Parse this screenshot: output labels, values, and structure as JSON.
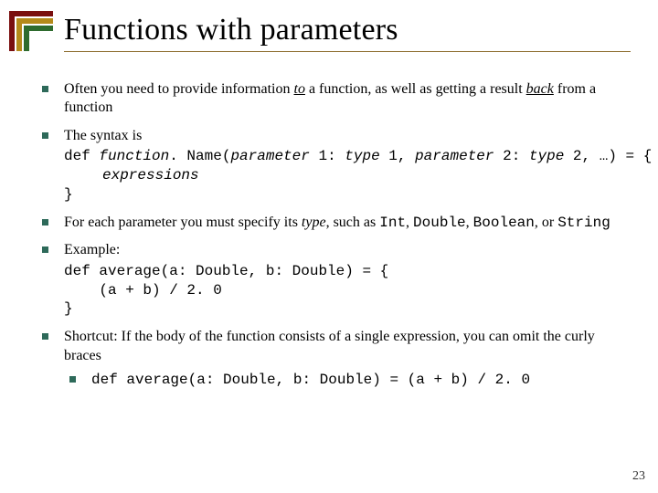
{
  "page_number": "23",
  "title": "Functions with parameters",
  "bullets": [
    {
      "text_parts": {
        "p1": "Often you need to provide information ",
        "i1": "to",
        "p2": " a function, as well as getting a result ",
        "i2": "back",
        "p3": " from a function"
      }
    },
    {
      "text": "The syntax is",
      "code": {
        "l1a": "def ",
        "l1b": "function",
        "l1c": ". Name(",
        "l1d": "parameter",
        "l1e": " 1: ",
        "l1f": "type",
        "l1g": " 1, ",
        "l1h": "parameter",
        "l1i": " 2: ",
        "l1j": "type",
        "l1k": " 2, …) = {",
        "l2": "expressions",
        "l3": "}"
      }
    },
    {
      "text_parts": {
        "p1": "For each parameter you must specify its ",
        "i1": "type",
        "p2": ", such as ",
        "c1": "Int",
        "p3": ", ",
        "c2": "Double",
        "p4": ", ",
        "c3": "Boolean",
        "p5": ", or ",
        "c4": "String"
      }
    },
    {
      "text": "Example:",
      "code": {
        "l1": "def average(a: Double, b: Double) = {",
        "l2": "    (a + b) / 2. 0",
        "l3": "}"
      }
    },
    {
      "text": "Shortcut: If the body of the function consists of a single expression, you can omit the curly braces",
      "subcode": "def average(a: Double, b: Double) = (a + b) / 2. 0"
    }
  ]
}
